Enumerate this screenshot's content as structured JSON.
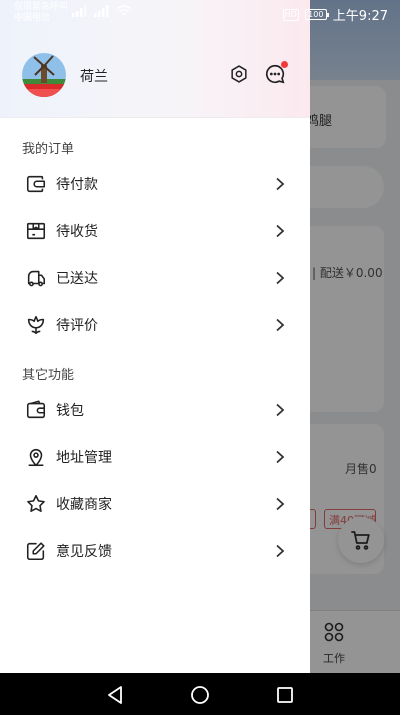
{
  "status_bar": {
    "carrier_line1": "仅限紧急呼叫",
    "carrier_line2": "中国电信",
    "hd": "HD",
    "battery": "100",
    "time": "上午9:27"
  },
  "background": {
    "text1": "鸡腿",
    "text2": "| 配送￥0.00",
    "text3": "月售0",
    "coupon2": "满40可减",
    "tab_label": "工作"
  },
  "drawer": {
    "user_name": "荷兰",
    "icons": {
      "settings": "settings-hex-icon",
      "messages": "message-icon"
    },
    "accent_color": "#f23a3a",
    "orders_title": "我的订单",
    "orders": [
      {
        "label": "待付款",
        "icon": "wallet-card-icon"
      },
      {
        "label": "待收货",
        "icon": "box-icon"
      },
      {
        "label": "已送达",
        "icon": "truck-icon"
      },
      {
        "label": "待评价",
        "icon": "flower-icon"
      }
    ],
    "other_title": "其它功能",
    "other": [
      {
        "label": "钱包",
        "icon": "wallet-icon"
      },
      {
        "label": "地址管理",
        "icon": "location-icon"
      },
      {
        "label": "收藏商家",
        "icon": "star-icon"
      },
      {
        "label": "意见反馈",
        "icon": "edit-icon"
      }
    ]
  }
}
